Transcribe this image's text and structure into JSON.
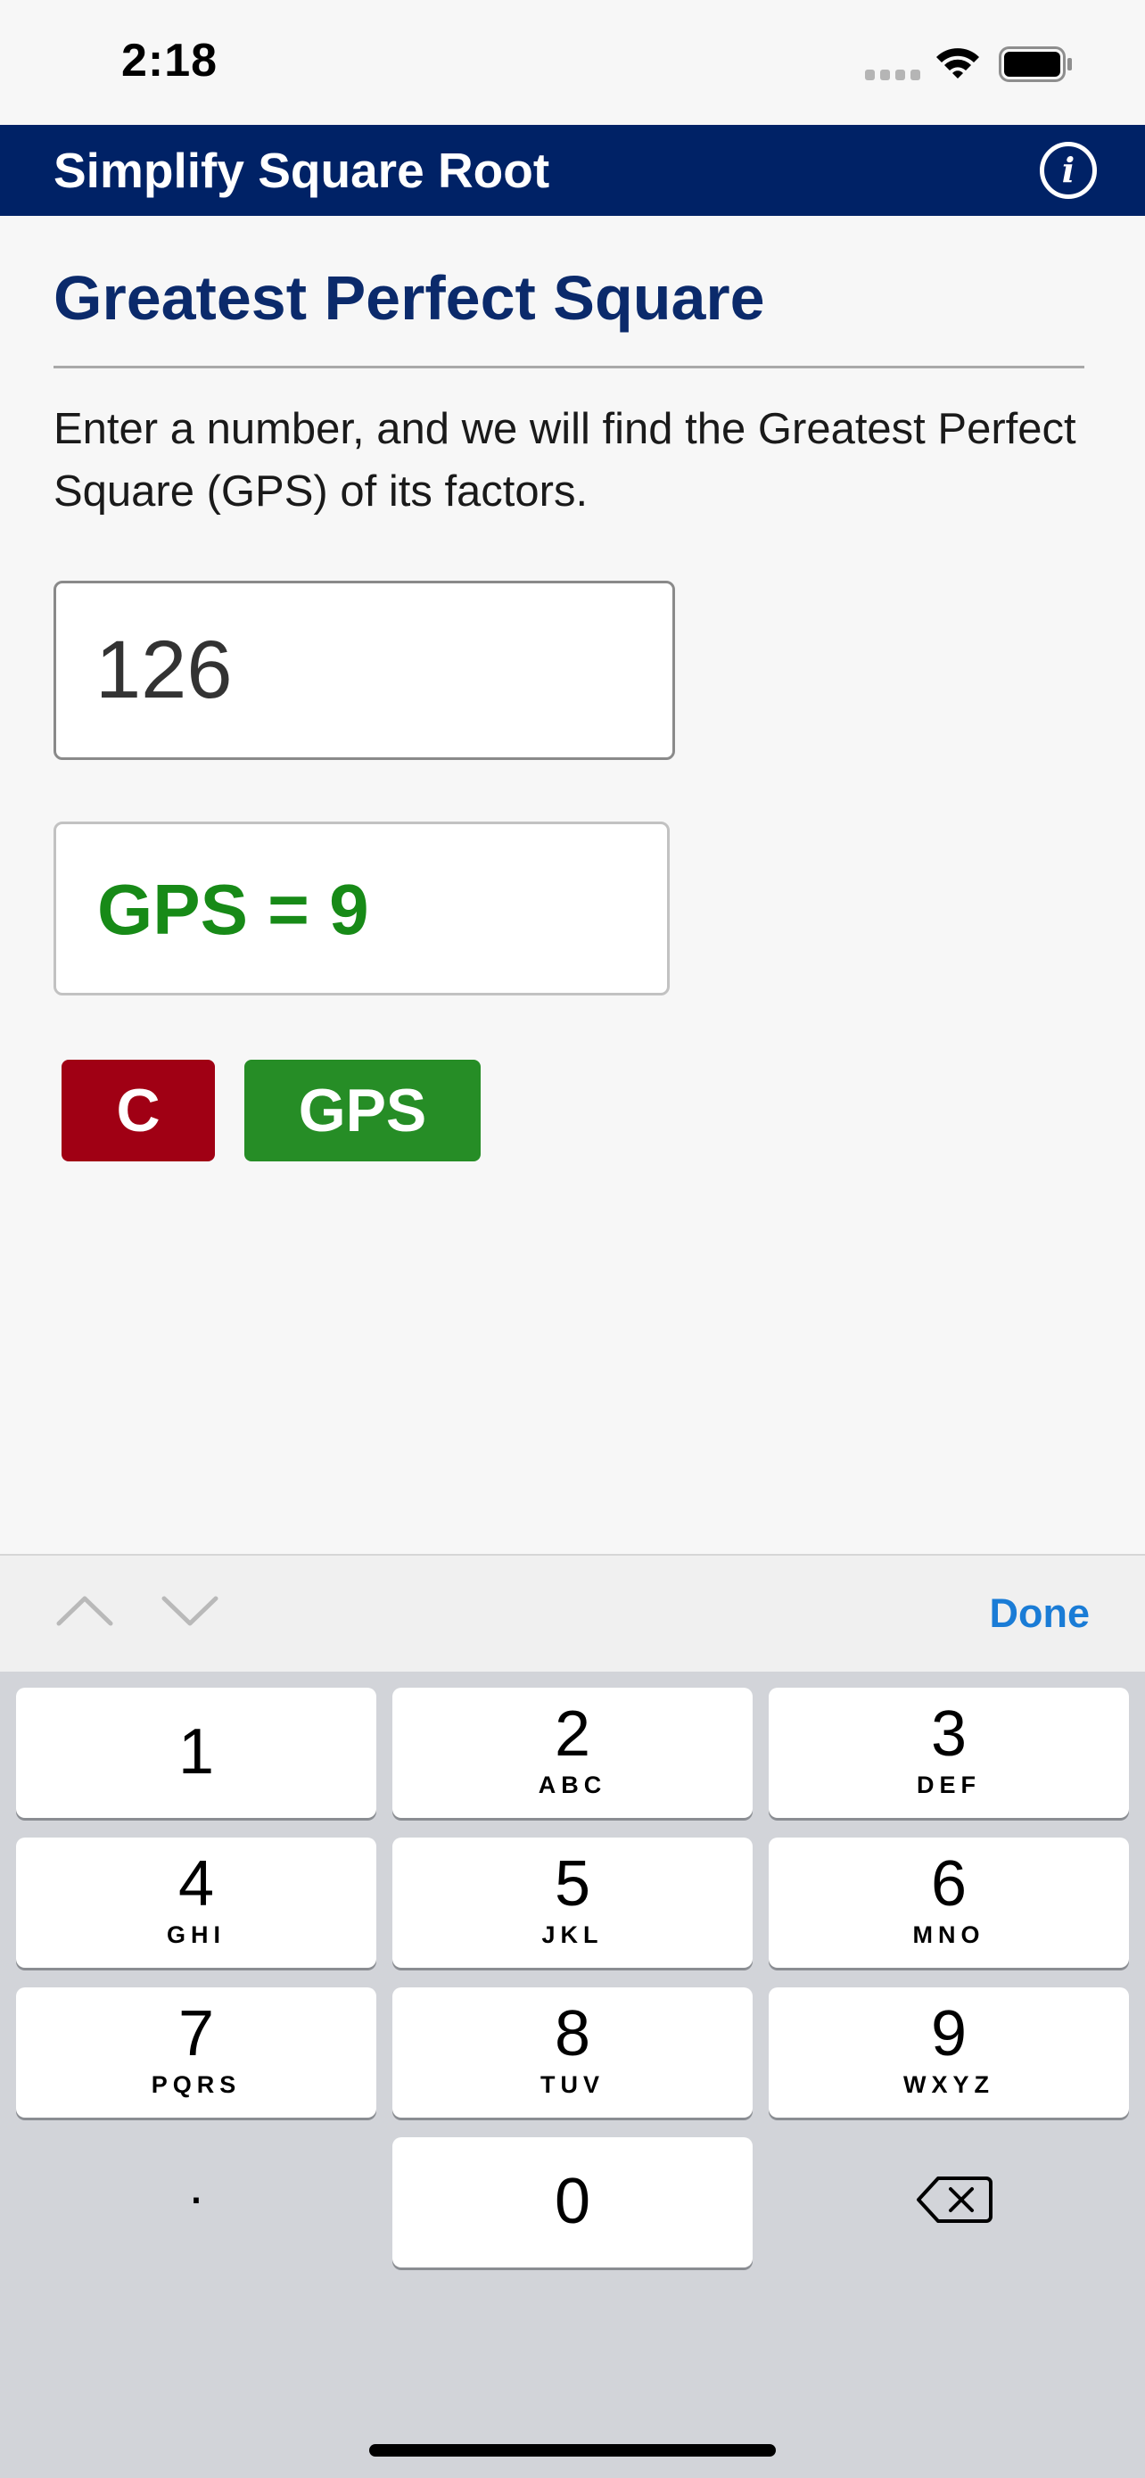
{
  "status_bar": {
    "time": "2:18"
  },
  "nav": {
    "title": "Simplify Square Root",
    "info_icon": "info-icon",
    "info_glyph": "i",
    "bar_color": "#002266"
  },
  "content": {
    "heading": "Greatest Perfect Square",
    "description": "Enter a number, and we will find the Greatest Perfect Square (GPS) of its factors.",
    "input_value": "126",
    "result": "GPS = 9"
  },
  "buttons": {
    "clear_label": "C",
    "clear_color": "#a00014",
    "gps_label": "GPS",
    "gps_color": "#268d26"
  },
  "accessory": {
    "prev_icon": "chevron-up-icon",
    "next_icon": "chevron-down-icon",
    "done_label": "Done"
  },
  "keypad": {
    "keys": [
      {
        "digit": "1",
        "letters": ""
      },
      {
        "digit": "2",
        "letters": "ABC"
      },
      {
        "digit": "3",
        "letters": "DEF"
      },
      {
        "digit": "4",
        "letters": "GHI"
      },
      {
        "digit": "5",
        "letters": "JKL"
      },
      {
        "digit": "6",
        "letters": "MNO"
      },
      {
        "digit": "7",
        "letters": "PQRS"
      },
      {
        "digit": "8",
        "letters": "TUV"
      },
      {
        "digit": "9",
        "letters": "WXYZ"
      },
      {
        "digit": "0",
        "letters": ""
      }
    ],
    "decimal": ".",
    "backspace_icon": "backspace-icon"
  }
}
